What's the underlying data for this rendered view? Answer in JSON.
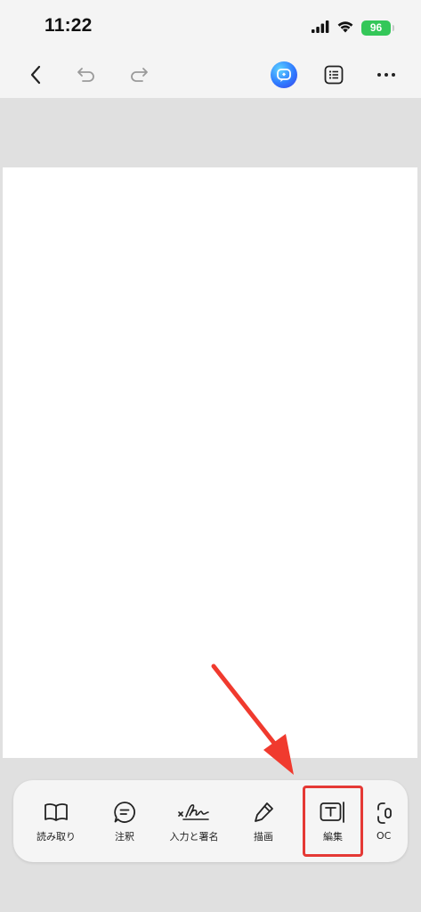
{
  "status_bar": {
    "time": "11:22",
    "battery": "96",
    "icons": [
      "signal-icon",
      "wifi-icon",
      "battery-icon"
    ]
  },
  "nav_bar": {
    "icons": [
      "back-icon",
      "undo-icon",
      "redo-icon",
      "ai-assistant-icon",
      "outline-list-icon",
      "more-icon"
    ]
  },
  "toolbar": {
    "items": [
      {
        "label": "読み取り",
        "icon": "book-icon"
      },
      {
        "label": "注釈",
        "icon": "comment-icon"
      },
      {
        "label": "入力と署名",
        "icon": "signature-icon"
      },
      {
        "label": "描画",
        "icon": "pen-icon"
      },
      {
        "label": "編集",
        "icon": "text-edit-icon"
      },
      {
        "label": "OC",
        "icon": "scan-icon"
      }
    ]
  },
  "colors": {
    "accent_highlight": "#e53935",
    "battery": "#34c759",
    "background": "#e0e0e0"
  }
}
